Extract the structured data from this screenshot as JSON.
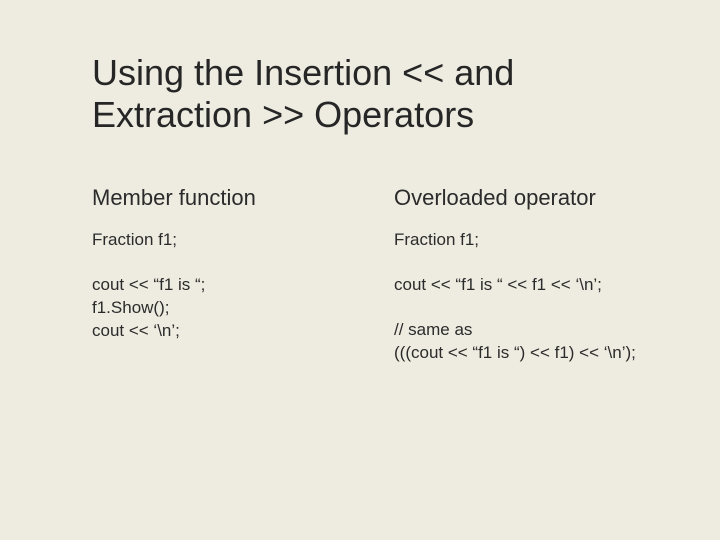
{
  "title": "Using the Insertion << and Extraction >> Operators",
  "left": {
    "head": "Member function",
    "block1": "Fraction f1;",
    "block2": "cout << “f1 is “;\nf1.Show();\ncout << ‘\\n’;"
  },
  "right": {
    "head": "Overloaded operator",
    "block1": "Fraction f1;",
    "block2": "cout << “f1 is “ << f1 << ‘\\n’;",
    "block3": "// same as\n(((cout << “f1 is “) << f1) << ‘\\n’);"
  }
}
